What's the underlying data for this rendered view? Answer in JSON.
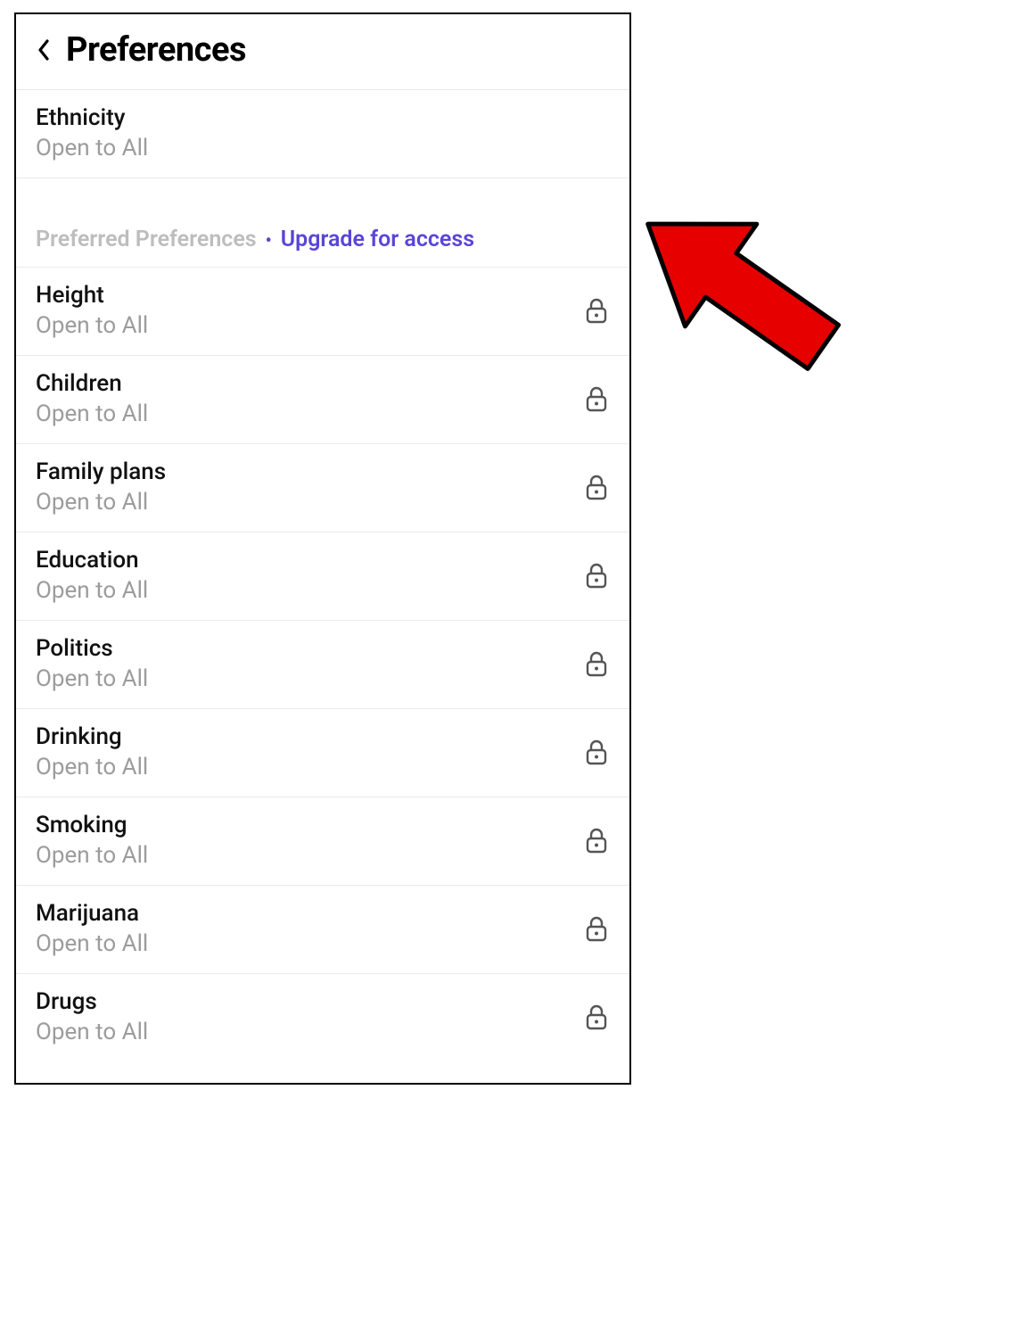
{
  "header": {
    "title": "Preferences"
  },
  "basic": {
    "items": [
      {
        "label": "Ethnicity",
        "value": "Open to All",
        "locked": false
      }
    ]
  },
  "section": {
    "label": "Preferred Preferences",
    "bullet": "•",
    "upgrade_text": "Upgrade for access"
  },
  "preferred": {
    "items": [
      {
        "label": "Height",
        "value": "Open to All",
        "locked": true
      },
      {
        "label": "Children",
        "value": "Open to All",
        "locked": true
      },
      {
        "label": "Family plans",
        "value": "Open to All",
        "locked": true
      },
      {
        "label": "Education",
        "value": "Open to All",
        "locked": true
      },
      {
        "label": "Politics",
        "value": "Open to All",
        "locked": true
      },
      {
        "label": "Drinking",
        "value": "Open to All",
        "locked": true
      },
      {
        "label": "Smoking",
        "value": "Open to All",
        "locked": true
      },
      {
        "label": "Marijuana",
        "value": "Open to All",
        "locked": true
      },
      {
        "label": "Drugs",
        "value": "Open to All",
        "locked": true
      }
    ]
  },
  "colors": {
    "accent": "#5a45d6",
    "text": "#111111",
    "muted": "#9c9c9c",
    "divider": "#eaeaea",
    "arrow": "#e60000"
  }
}
